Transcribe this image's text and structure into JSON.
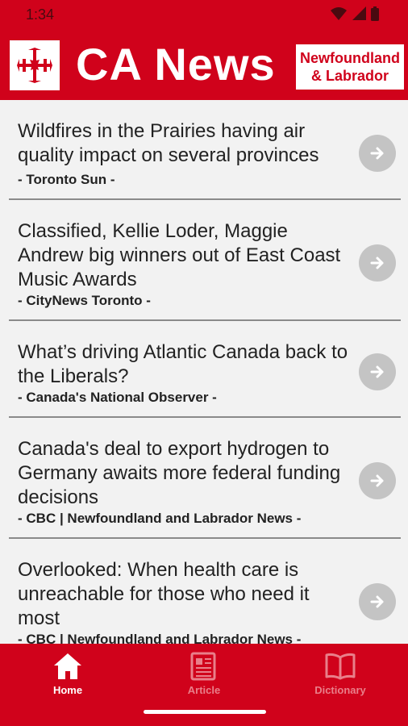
{
  "status_bar": {
    "time": "1:34",
    "icons": [
      "wifi-icon",
      "signal-icon",
      "battery-icon"
    ]
  },
  "header": {
    "logo_icon": "canada-flag-logo",
    "title": "CA News",
    "region_line1": "Newfoundland",
    "region_line2": "& Labrador"
  },
  "articles": [
    {
      "title": "Wildfires in the Prairies having air quality impact on several provinces",
      "source": "- Toronto Sun -"
    },
    {
      "title": "Classified, Kellie Loder, Maggie Andrew big winners out of East Coast Music Awards",
      "source": "- CityNews Toronto -"
    },
    {
      "title": "What’s driving Atlantic Canada back to the Liberals?",
      "source": "- Canada's National Observer -"
    },
    {
      "title": "Canada's deal to export hydrogen to Germany awaits more federal funding decisions",
      "source": "- CBC | Newfoundland and Labrador News -"
    },
    {
      "title": "Overlooked: When health care is unreachable for those who need it most",
      "source": "- CBC | Newfoundland and Labrador News -"
    }
  ],
  "bottom_nav": {
    "items": [
      {
        "label": "Home",
        "icon": "home-icon",
        "active": true
      },
      {
        "label": "Article",
        "icon": "newspaper-icon",
        "active": false
      },
      {
        "label": "Dictionary",
        "icon": "book-icon",
        "active": false
      }
    ]
  },
  "colors": {
    "brand_red": "#d0021b",
    "background": "#f2f2f2",
    "arrow_button": "#c4c4c4",
    "nav_inactive": "#e97f8a"
  }
}
